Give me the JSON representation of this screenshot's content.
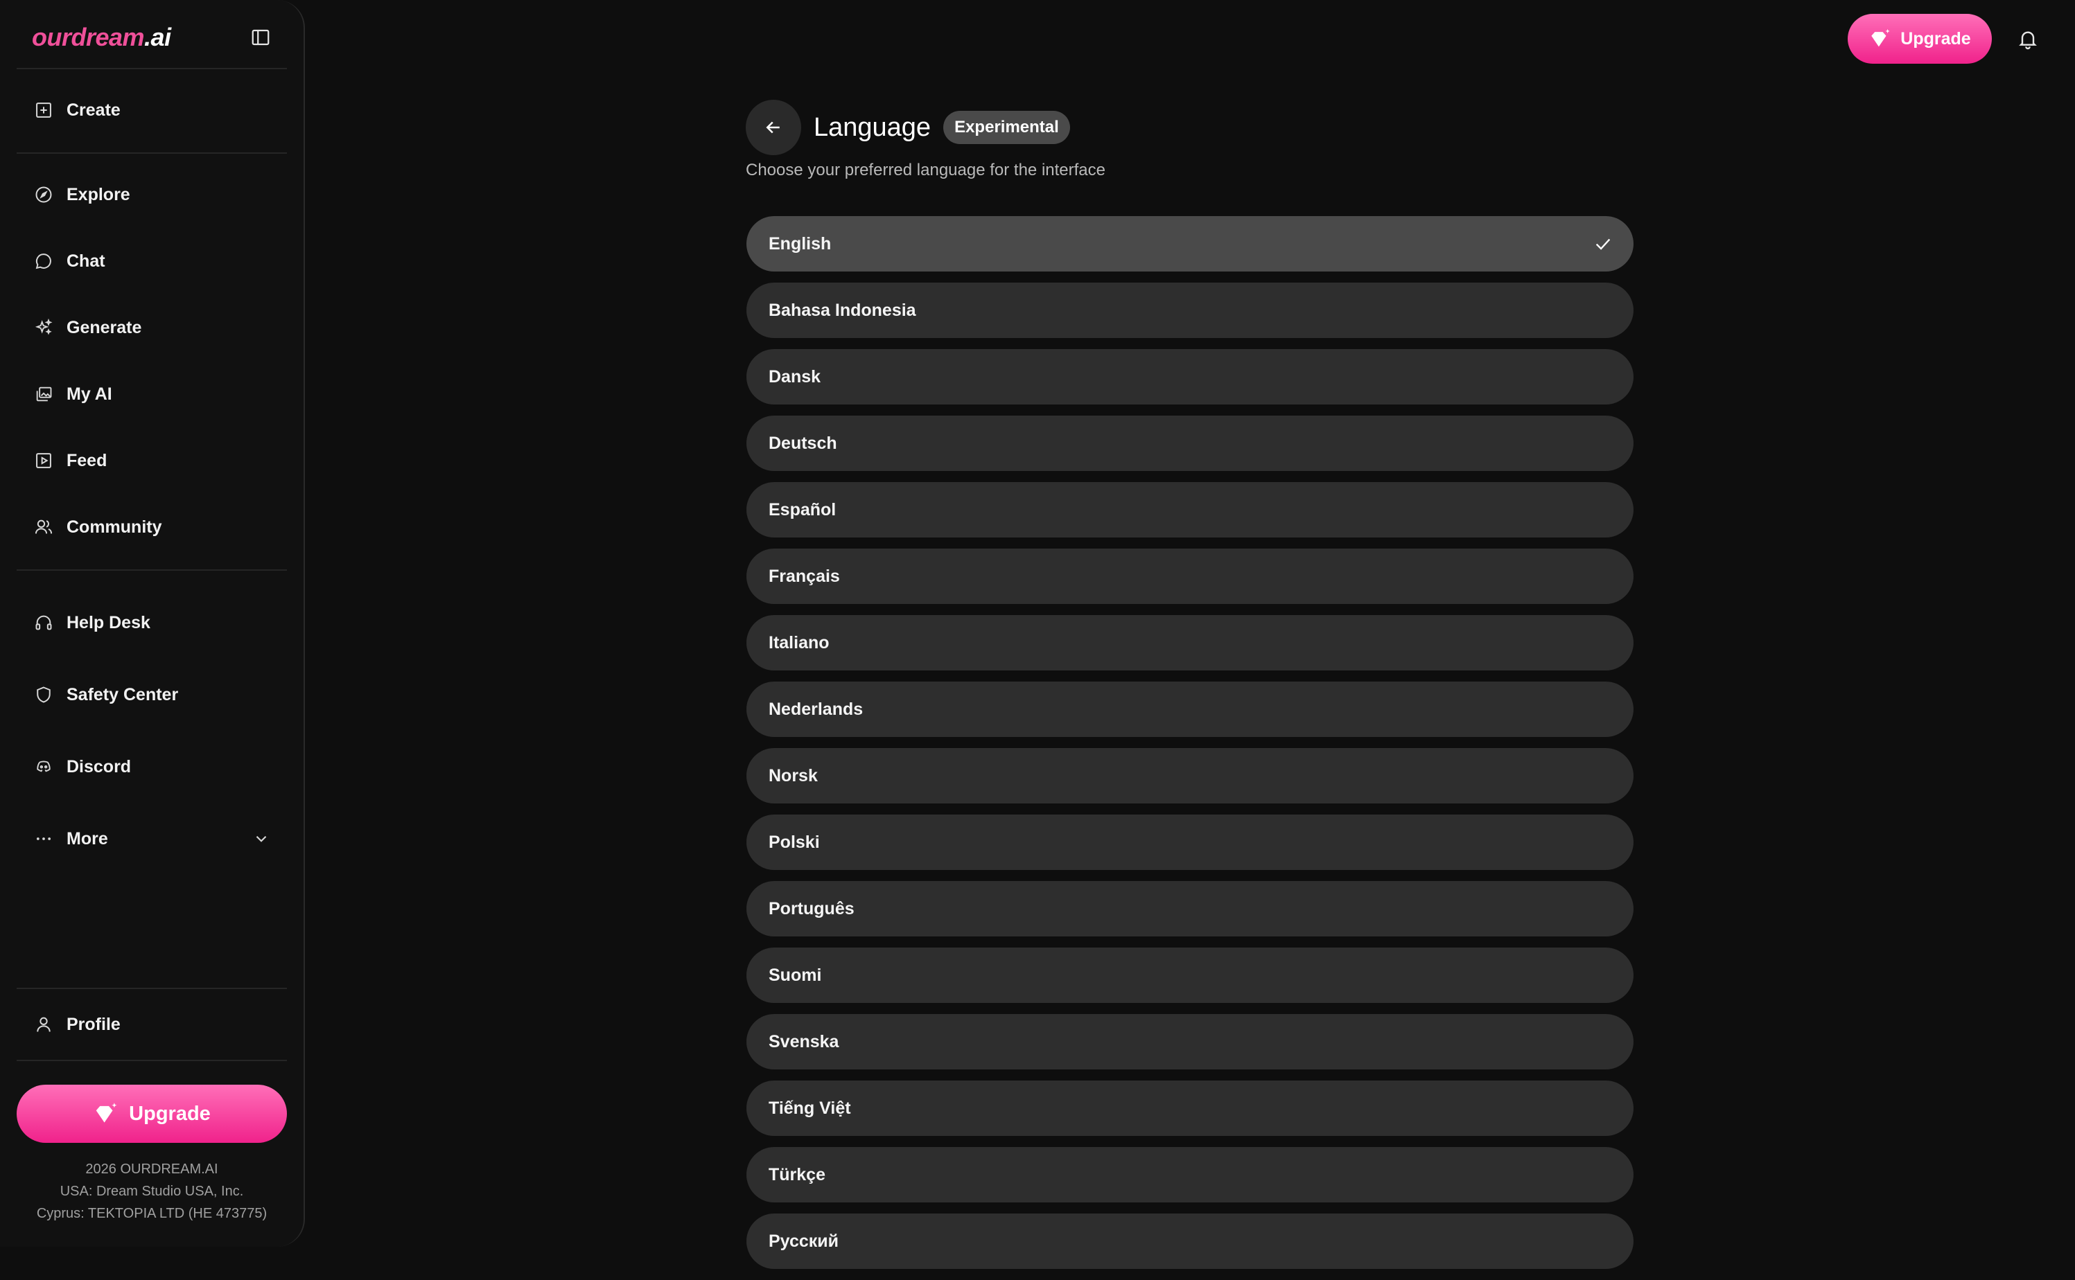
{
  "brand": {
    "part1": "ourdream",
    "part2": ".ai"
  },
  "sidebar": {
    "nav_primary": [
      {
        "label": "Create",
        "icon": "plus-square-icon"
      }
    ],
    "nav_main": [
      {
        "label": "Explore",
        "icon": "compass-icon"
      },
      {
        "label": "Chat",
        "icon": "chat-bubble-icon"
      },
      {
        "label": "Generate",
        "icon": "sparkles-icon"
      },
      {
        "label": "My AI",
        "icon": "gallery-icon"
      },
      {
        "label": "Feed",
        "icon": "play-square-icon"
      },
      {
        "label": "Community",
        "icon": "users-icon"
      }
    ],
    "nav_support": [
      {
        "label": "Help Desk",
        "icon": "headset-icon"
      },
      {
        "label": "Safety Center",
        "icon": "shield-icon"
      },
      {
        "label": "Discord",
        "icon": "discord-icon"
      },
      {
        "label": "More",
        "icon": "ellipsis-icon"
      }
    ],
    "profile_label": "Profile",
    "upgrade_label": "Upgrade",
    "footer": {
      "line1": "2026 OURDREAM.AI",
      "line2": "USA: Dream Studio USA, Inc.",
      "line3": "Cyprus: TEKTOPIA LTD (HE 473775)"
    }
  },
  "topbar": {
    "upgrade_label": "Upgrade"
  },
  "main": {
    "title": "Language",
    "badge": "Experimental",
    "subtitle": "Choose your preferred language for the interface",
    "selected_index": 0,
    "languages": [
      "English",
      "Bahasa Indonesia",
      "Dansk",
      "Deutsch",
      "Español",
      "Français",
      "Italiano",
      "Nederlands",
      "Norsk",
      "Polski",
      "Português",
      "Suomi",
      "Svenska",
      "Tiếng Việt",
      "Türkçe",
      "Русский"
    ]
  },
  "colors": {
    "accent_pink": "#f0228b",
    "accent_pink_light": "#ff6fb8",
    "background": "#0e0e0e",
    "item_bg": "#2e2e2e",
    "item_selected_bg": "#4a4a4a"
  }
}
